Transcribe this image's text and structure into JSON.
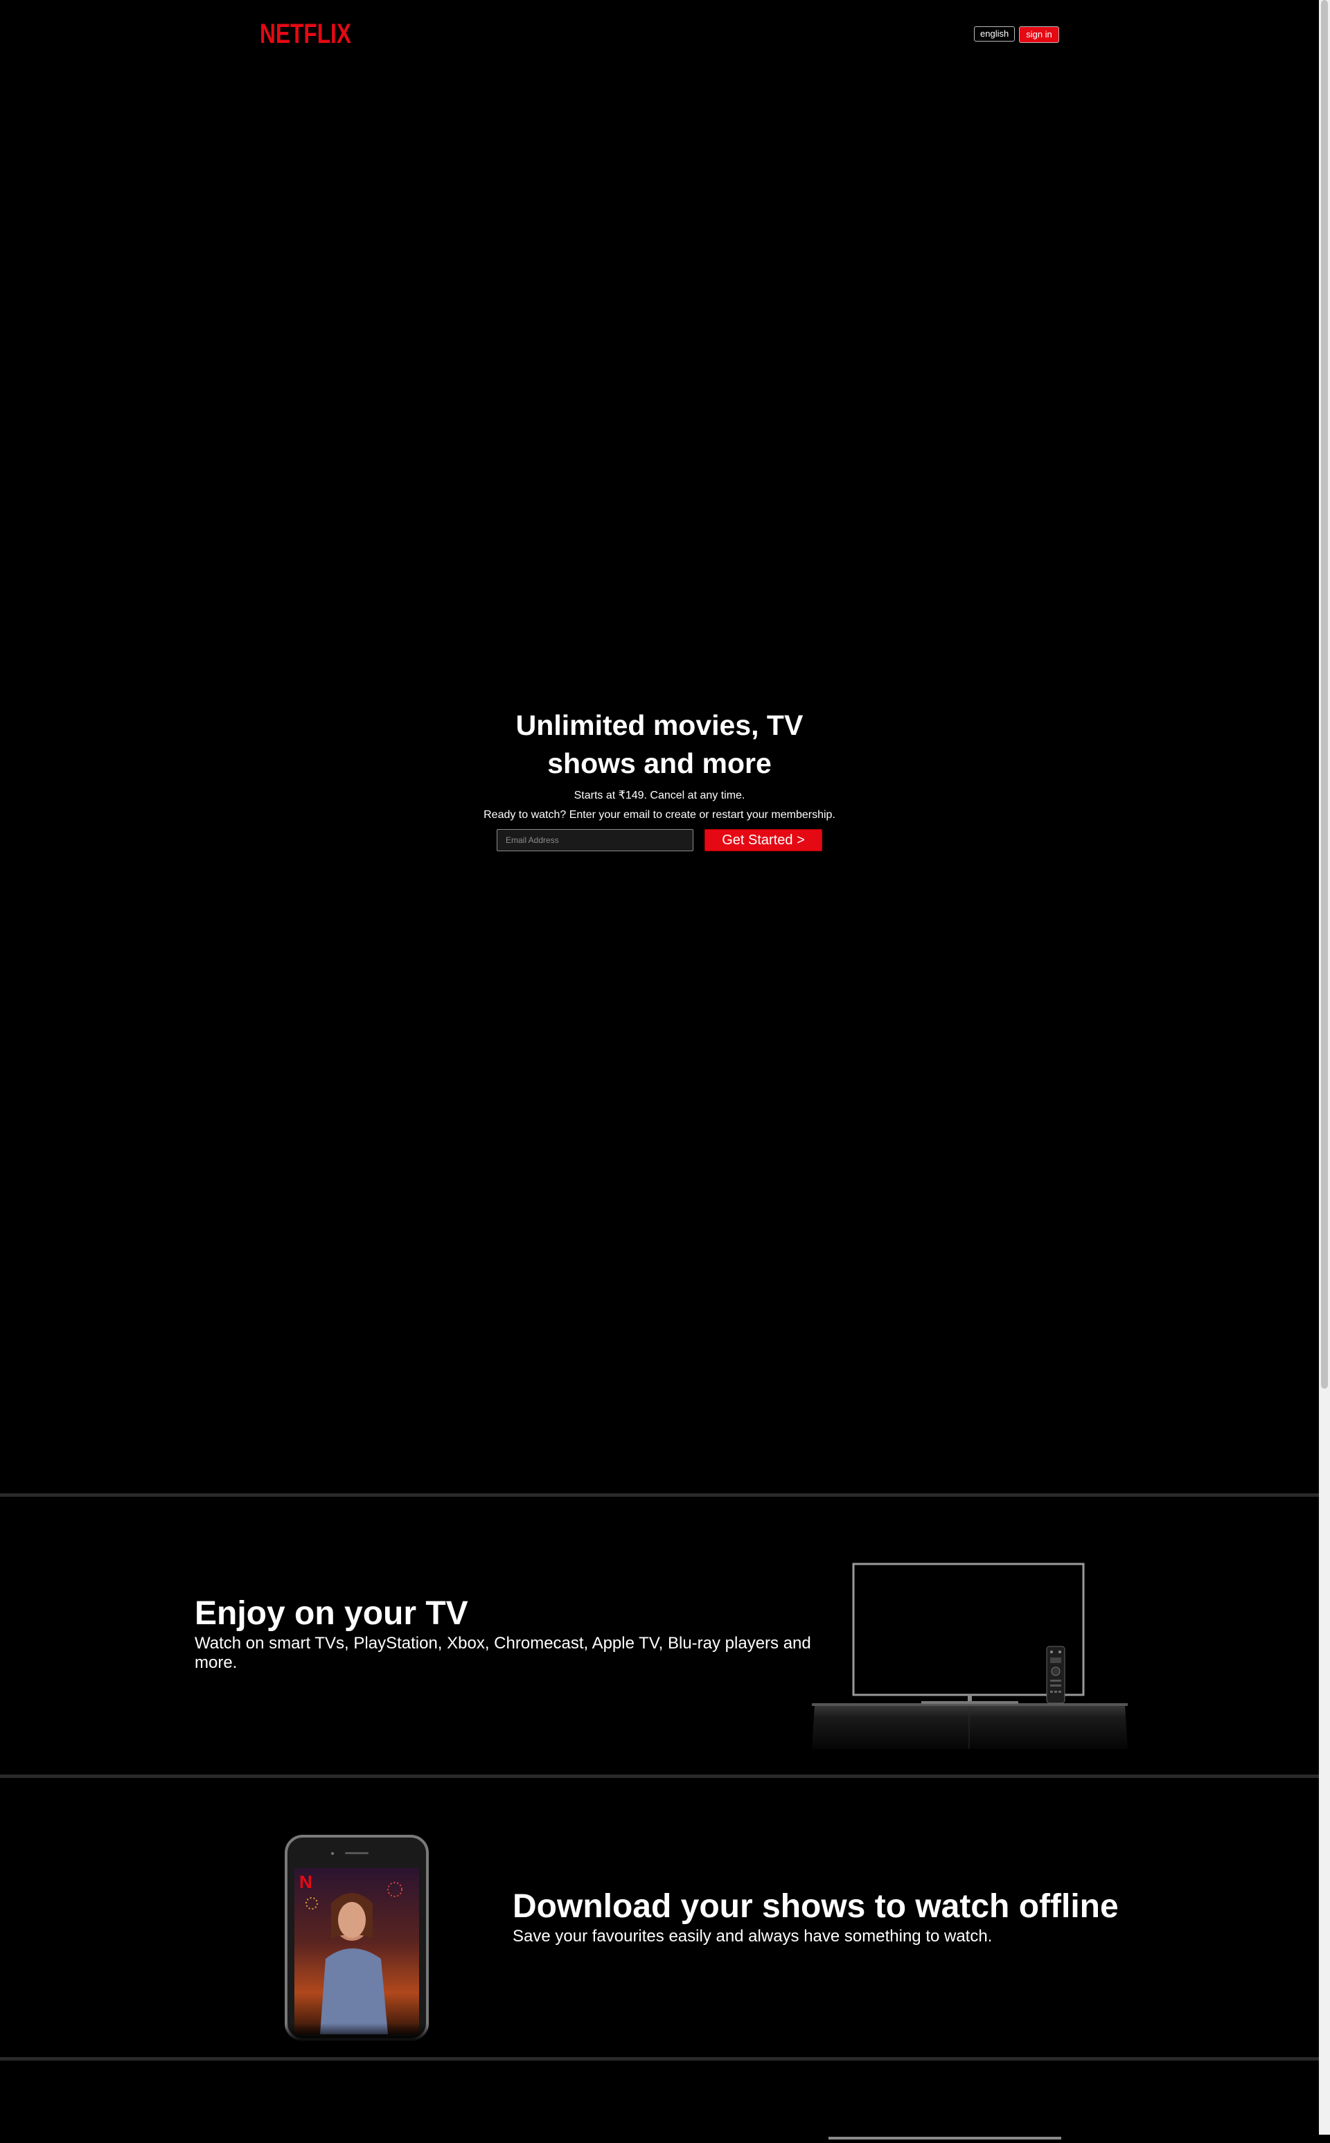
{
  "header": {
    "logo_text": "NETFLIX",
    "language_label": "english",
    "signin_label": "sign in"
  },
  "hero": {
    "title": "Unlimited movies, TV shows and more",
    "subtitle": "Starts at ₹149. Cancel at any time.",
    "ready_text": "Ready to watch? Enter your email to create or restart your membership.",
    "email_placeholder": "Email Address",
    "cta_label": "Get Started >"
  },
  "features": [
    {
      "title": "Enjoy on your TV",
      "description": "Watch on smart TVs, PlayStation, Xbox, Chromecast, Apple TV, Blu-ray players and more."
    },
    {
      "title": "Download your shows to watch offline",
      "description": "Save your favourites easily and always have something to watch."
    }
  ],
  "colors": {
    "brand_red": "#e50914",
    "background": "#000000",
    "divider": "#2a2a2a"
  },
  "icons": [
    "netflix-logo",
    "tv-illustration",
    "phone-illustration"
  ]
}
